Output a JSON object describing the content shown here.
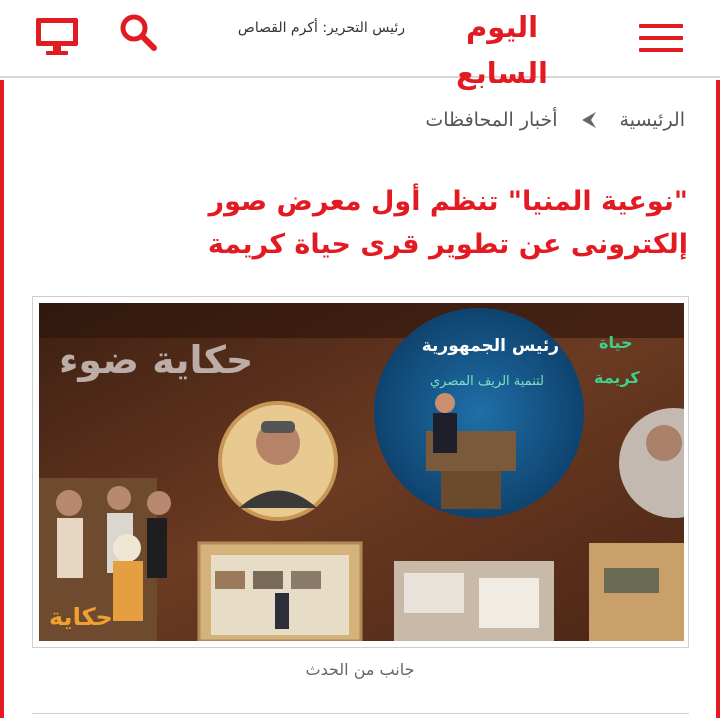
{
  "header": {
    "logo_text": "اليوم السابع",
    "editor_label": "رئيس التحرير:",
    "editor_name": "أكرم القصاص"
  },
  "breadcrumb": {
    "home": "الرئيسية",
    "section": "أخبار المحافظات"
  },
  "article": {
    "headline": "\"نوعية المنيا\" تنظم أول معرض صور إلكترونى عن تطوير قرى حياة كريمة",
    "image_caption": "جانب من الحدث"
  },
  "image_text": {
    "title": "حكاية ضوء",
    "screen_line1": "رئيس الجمهورية",
    "screen_line2": "لتنمية الريف المصري",
    "side_line1": "حياة",
    "side_line2": "كريمة",
    "poster_title": "حكاية"
  },
  "colors": {
    "brand_red": "#e21b23",
    "image_bg": "#5a2e1a"
  },
  "icons": {
    "tv": "tv-icon",
    "search": "search-icon",
    "menu": "hamburger-menu-icon",
    "breadcrumb_sep": "chevron-left-icon"
  }
}
